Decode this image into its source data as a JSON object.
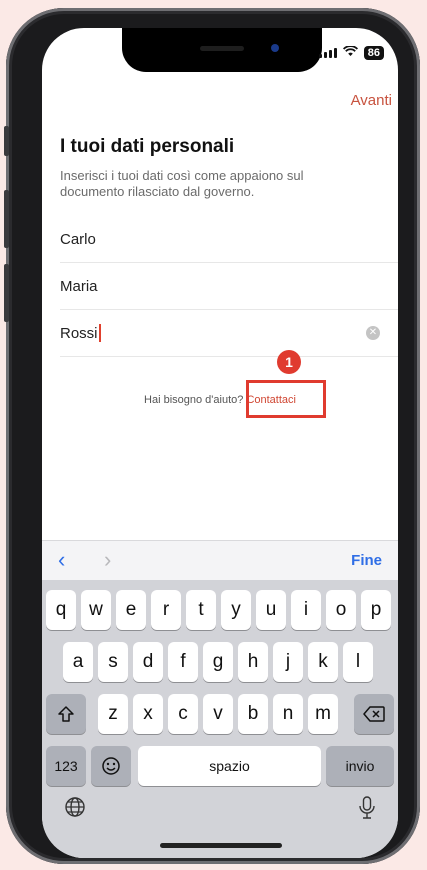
{
  "status_bar": {
    "battery": "86"
  },
  "header": {
    "next_label": "Avanti",
    "title": "I tuoi dati personali",
    "subtitle": "Inserisci i tuoi dati così come appaiono sul documento rilasciato dal governo."
  },
  "fields": [
    {
      "value": "Carlo"
    },
    {
      "value": "Maria"
    },
    {
      "value": "Rossi"
    }
  ],
  "help": {
    "text": "Hai bisogno d'aiuto? ",
    "link": "Contattaci"
  },
  "annotation": {
    "badge": "1"
  },
  "accessory": {
    "done_label": "Fine"
  },
  "keyboard": {
    "row1": [
      "q",
      "w",
      "e",
      "r",
      "t",
      "y",
      "u",
      "i",
      "o",
      "p"
    ],
    "row2": [
      "a",
      "s",
      "d",
      "f",
      "g",
      "h",
      "j",
      "k",
      "l"
    ],
    "row3": [
      "z",
      "x",
      "c",
      "v",
      "b",
      "n",
      "m"
    ],
    "numbers_label": "123",
    "space_label": "spazio",
    "return_label": "invio"
  },
  "colors": {
    "accent": "#c8533f",
    "highlight": "#e03b2f",
    "link": "#2f6ee6"
  }
}
